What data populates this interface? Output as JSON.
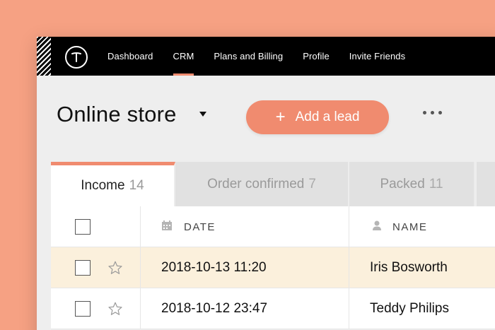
{
  "nav": {
    "items": [
      {
        "label": "Dashboard",
        "active": false
      },
      {
        "label": "CRM",
        "active": true
      },
      {
        "label": "Plans and Billing",
        "active": false
      },
      {
        "label": "Profile",
        "active": false
      },
      {
        "label": "Invite Friends",
        "active": false
      }
    ]
  },
  "header": {
    "title": "Online store",
    "add_label": "Add a lead",
    "add_icon": "plus-icon",
    "more_icon": "more-icon"
  },
  "tabs": [
    {
      "label": "Income",
      "count": "14",
      "active": true
    },
    {
      "label": "Order confirmed",
      "count": "7",
      "active": false
    },
    {
      "label": "Packed",
      "count": "11",
      "active": false
    }
  ],
  "table": {
    "columns": {
      "date": {
        "label": "DATE",
        "icon": "calendar-icon"
      },
      "name": {
        "label": "NAME",
        "icon": "person-icon"
      }
    },
    "rows": [
      {
        "date": "2018-10-13 11:20",
        "name": "Iris Bosworth",
        "highlight": true
      },
      {
        "date": "2018-10-12 23:47",
        "name": "Teddy Philips",
        "highlight": false
      }
    ]
  },
  "colors": {
    "accent": "#f08b6f",
    "background": "#f6a183",
    "topbar": "#000000",
    "highlight_row": "#fbf0dc"
  }
}
